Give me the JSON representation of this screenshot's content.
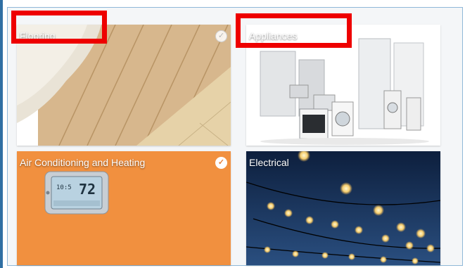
{
  "categories": [
    {
      "label": "Flooring",
      "selected": false,
      "icon": "check-icon"
    },
    {
      "label": "Appliances",
      "selected": false,
      "icon": "check-icon"
    },
    {
      "label": "Air Conditioning and Heating",
      "selected": true,
      "icon": "check-icon"
    },
    {
      "label": "Electrical",
      "selected": false,
      "icon": "check-icon"
    }
  ],
  "thermostat": {
    "display_time": "10:5",
    "display_temp": "72"
  },
  "colors": {
    "highlight": "#ee0000",
    "ac_tile": "#f1903f",
    "electrical_tile": "#163055"
  },
  "check_glyph": "✓"
}
